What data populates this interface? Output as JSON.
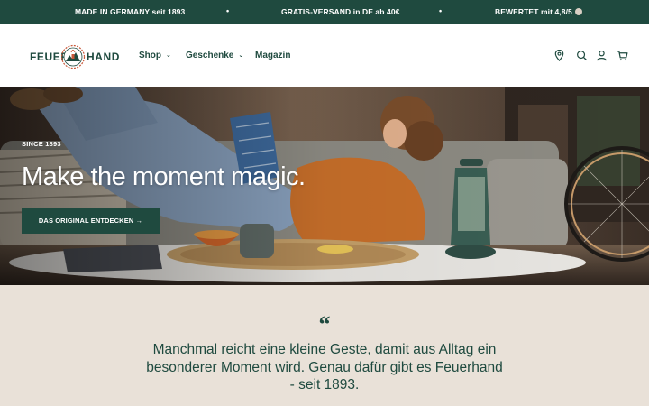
{
  "announcement": {
    "items": [
      "MADE IN GERMANY seit 1893",
      "GRATIS-VERSAND in DE ab 40€",
      "BEWERTET mit 4,8/5"
    ],
    "separator": "•"
  },
  "header": {
    "logo_left": "FEUER",
    "logo_right": "HAND",
    "nav": [
      {
        "label": "Shop",
        "has_dropdown": true
      },
      {
        "label": "Geschenke",
        "has_dropdown": true
      },
      {
        "label": "Magazin",
        "has_dropdown": false
      }
    ],
    "icons": [
      "location-pin-icon",
      "search-icon",
      "account-icon",
      "cart-icon"
    ]
  },
  "hero": {
    "eyebrow": "SINCE 1893",
    "title": "Make the moment magic.",
    "cta": "DAS ORIGINAL ENTDECKEN →"
  },
  "quote": {
    "mark": "“",
    "text": "Manchmal reicht eine kleine Geste, damit aus Alltag ein besonderer Moment wird. Genau dafür gibt es Feuerhand - seit 1893."
  },
  "colors": {
    "brand_green": "#1f4a3f",
    "quote_bg": "#e9e1d8",
    "header_bg": "#ffffff"
  }
}
